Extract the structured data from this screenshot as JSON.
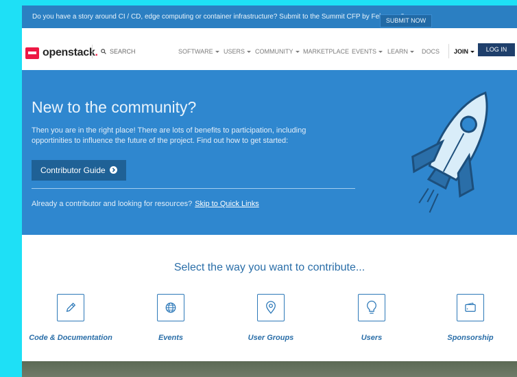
{
  "announcement": {
    "text": "Do you have a story around CI / CD, edge computing or container infrastructure? Submit to the Summit CFP by February 8",
    "button": "SUBMIT NOW"
  },
  "nav": {
    "logo_text": "openstack",
    "logo_dot": ".",
    "search_placeholder": "SEARCH",
    "items": [
      {
        "label": "SOFTWARE",
        "dropdown": true
      },
      {
        "label": "USERS",
        "dropdown": true
      },
      {
        "label": "COMMUNITY",
        "dropdown": true
      },
      {
        "label": "MARKETPLACE",
        "dropdown": false
      },
      {
        "label": "EVENTS",
        "dropdown": true
      },
      {
        "label": "LEARN",
        "dropdown": true
      },
      {
        "label": "DOCS",
        "dropdown": false
      }
    ],
    "join": "JOIN",
    "login": "LOG IN"
  },
  "hero": {
    "title": "New to the community?",
    "body": "Then you are in the right place! There are lots of benefits to participation, including opportinities to influence the future of the project. Find out how to get started:",
    "button": "Contributor Guide",
    "foot_text": "Already a contributor and looking for resources?",
    "foot_link": "Skip to Quick Links"
  },
  "contribute": {
    "title": "Select the way you want to contribute...",
    "tiles": [
      {
        "label": "Code & Documentation",
        "icon": "pencil-icon"
      },
      {
        "label": "Events",
        "icon": "globe-icon"
      },
      {
        "label": "User Groups",
        "icon": "map-pin-icon"
      },
      {
        "label": "Users",
        "icon": "lightbulb-icon"
      },
      {
        "label": "Sponsorship",
        "icon": "wallet-icon"
      }
    ]
  },
  "colors": {
    "announcement_bg": "#2b7fc2",
    "hero_bg": "#2f87cf",
    "accent": "#2a6ea8",
    "login_bg": "#1f3f6b",
    "brand_red": "#ed1944"
  }
}
